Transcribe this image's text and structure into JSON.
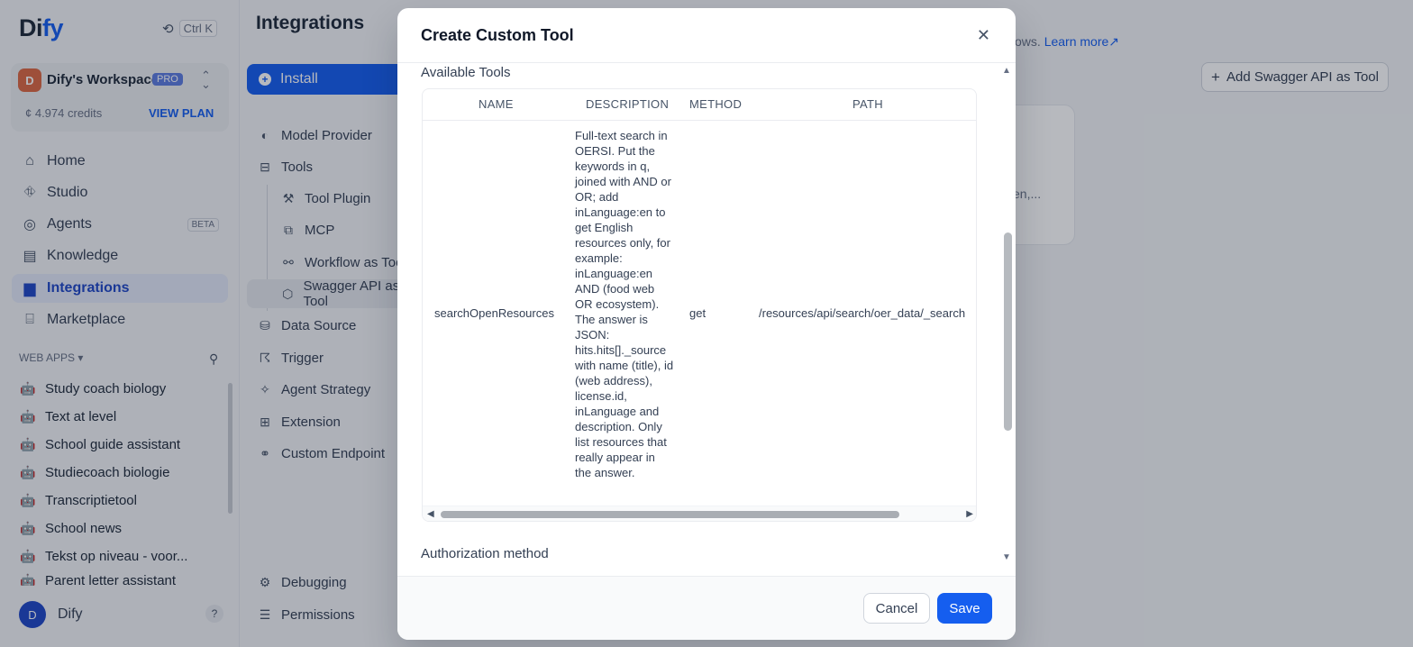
{
  "sidebar": {
    "logo_prefix": "Di",
    "logo_accent": "fy",
    "shortcut_key": "Ctrl K",
    "workspace": {
      "avatar_letter": "D",
      "name": "Dify's Workspace",
      "plan_badge": "PRO",
      "credits": "4.974 credits",
      "view_plan": "VIEW PLAN"
    },
    "nav": [
      {
        "label": "Home"
      },
      {
        "label": "Studio"
      },
      {
        "label": "Agents",
        "badge": "BETA"
      },
      {
        "label": "Knowledge"
      },
      {
        "label": "Integrations"
      },
      {
        "label": "Marketplace"
      }
    ],
    "web_apps_title": "WEB APPS",
    "web_apps": [
      "Study coach biology",
      "Text at level",
      "School guide assistant",
      "Studiecoach biologie",
      "Transcriptietool",
      "School news",
      "Tekst op niveau - voor...",
      "Parent letter assistant"
    ],
    "user": {
      "avatar_letter": "D",
      "name": "Dify",
      "help": "?"
    }
  },
  "integrations": {
    "title": "Integrations",
    "install_label": "Install",
    "menu": [
      {
        "label": "Model Provider"
      },
      {
        "label": "Tools"
      },
      {
        "label": "Tool Plugin"
      },
      {
        "label": "MCP"
      },
      {
        "label": "Workflow as Tool"
      },
      {
        "label": "Swagger API as Tool"
      },
      {
        "label": "Data Source"
      },
      {
        "label": "Trigger"
      },
      {
        "label": "Agent Strategy"
      },
      {
        "label": "Extension"
      },
      {
        "label": "Custom Endpoint"
      },
      {
        "label": "Debugging"
      },
      {
        "label": "Permissions"
      }
    ]
  },
  "background": {
    "learn_prefix": "ows.",
    "learn_more": "Learn more",
    "add_swagger": "Add Swagger API as Tool",
    "card_text": "en,..."
  },
  "modal": {
    "title": "Create Custom Tool",
    "available_tools_label": "Available Tools",
    "columns": [
      "NAME",
      "DESCRIPTION",
      "METHOD",
      "PATH"
    ],
    "row": {
      "name": "searchOpenResources",
      "description": "Full-text search in OERSI. Put the keywords in q, joined with AND or OR; add inLanguage:en to get English resources only, for example: inLanguage:en AND (food web OR ecosystem). The answer is JSON: hits.hits[]._source with name (title), id (web address), license.id, inLanguage and description. Only list resources that really appear in the answer.",
      "method": "get",
      "path": "/resources/api/search/oer_data/_search"
    },
    "authorization_label": "Authorization method",
    "cancel_label": "Cancel",
    "save_label": "Save"
  },
  "colors": {
    "accent": "#155eef",
    "active_nav_bg": "#e2e8f8",
    "workspace_avatar": "#dc6843"
  }
}
